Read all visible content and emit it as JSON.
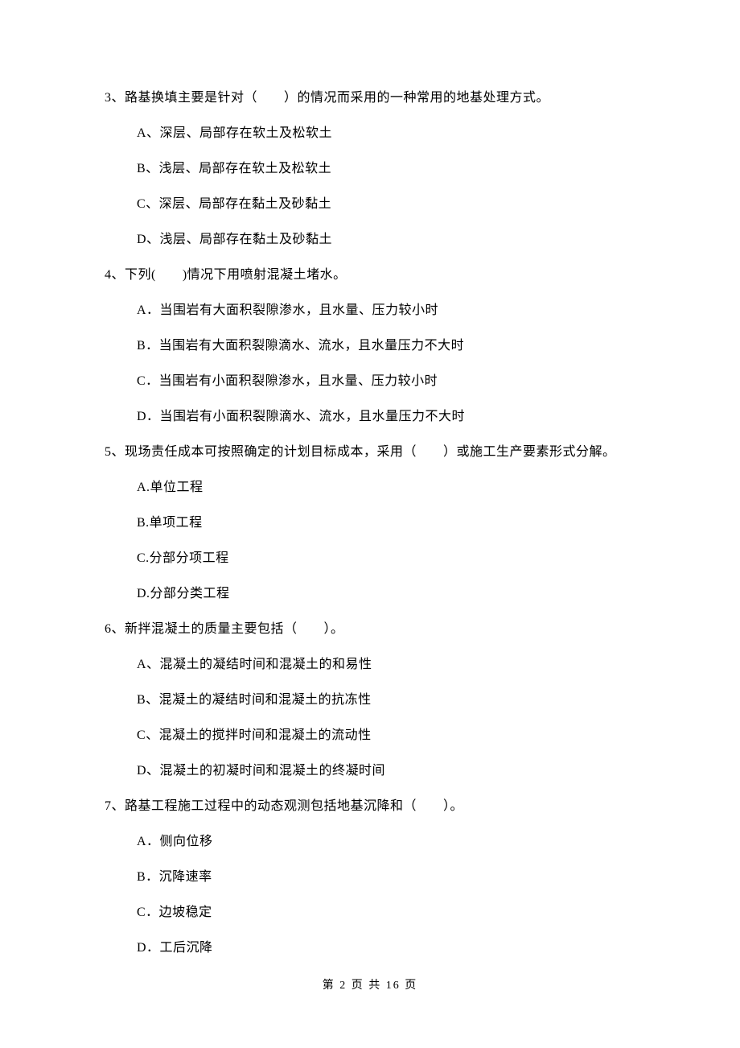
{
  "questions": [
    {
      "stem": "3、路基换填主要是针对（　　）的情况而采用的一种常用的地基处理方式。",
      "options": [
        "A、深层、局部存在软土及松软土",
        "B、浅层、局部存在软土及松软土",
        "C、深层、局部存在黏土及砂黏土",
        "D、浅层、局部存在黏土及砂黏土"
      ]
    },
    {
      "stem": "4、下列(　　)情况下用喷射混凝土堵水。",
      "options": [
        "A．当围岩有大面积裂隙渗水，且水量、压力较小时",
        "B．当围岩有大面积裂隙滴水、流水，且水量压力不大时",
        "C．当围岩有小面积裂隙渗水，且水量、压力较小时",
        "D．当围岩有小面积裂隙滴水、流水，且水量压力不大时"
      ]
    },
    {
      "stem": "5、现场责任成本可按照确定的计划目标成本，采用（　　）或施工生产要素形式分解。",
      "options": [
        "A.单位工程",
        "B.单项工程",
        "C.分部分项工程",
        "D.分部分类工程"
      ]
    },
    {
      "stem": "6、新拌混凝土的质量主要包括（　　）。",
      "options": [
        "A、混凝土的凝结时间和混凝土的和易性",
        "B、混凝土的凝结时间和混凝土的抗冻性",
        "C、混凝土的搅拌时间和混凝土的流动性",
        "D、混凝土的初凝时间和混凝土的终凝时间"
      ]
    },
    {
      "stem": "7、路基工程施工过程中的动态观测包括地基沉降和（　　）。",
      "options": [
        "A．侧向位移",
        "B．沉降速率",
        "C．边坡稳定",
        "D．工后沉降"
      ]
    }
  ],
  "footer": "第 2 页 共 16 页"
}
